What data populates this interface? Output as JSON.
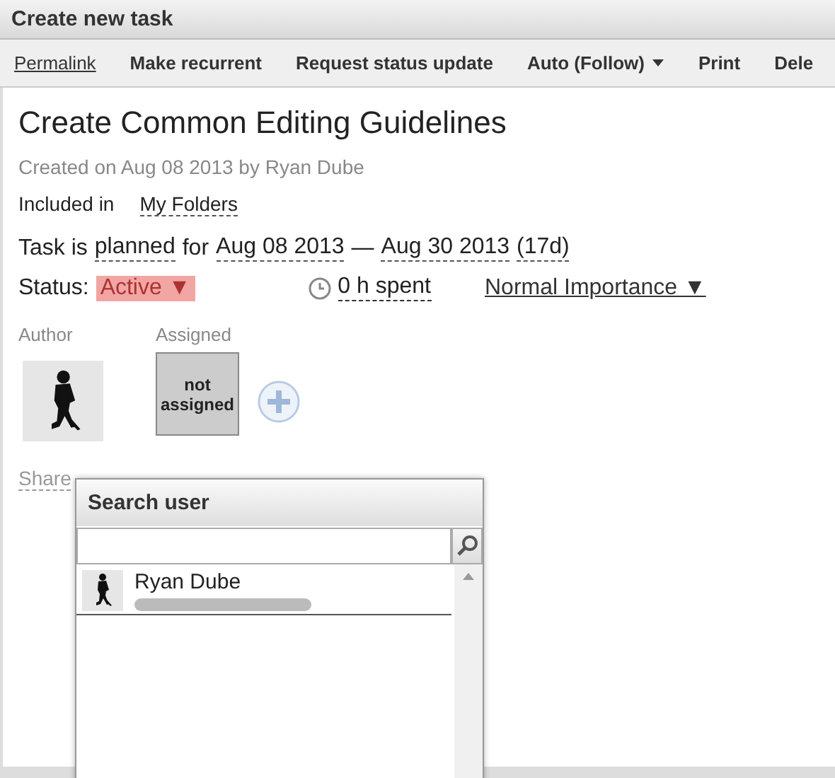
{
  "window": {
    "title": "Create new task"
  },
  "toolbar": [
    {
      "label": "Permalink",
      "kind": "link"
    },
    {
      "label": "Make recurrent",
      "kind": "action"
    },
    {
      "label": "Request status update",
      "kind": "action"
    },
    {
      "label": "Auto (Follow)",
      "kind": "dropdown"
    },
    {
      "label": "Print",
      "kind": "action"
    },
    {
      "label": "Dele",
      "kind": "action"
    }
  ],
  "task": {
    "title": "Create Common Editing Guidelines",
    "created": "Created on Aug 08 2013 by Ryan Dube",
    "included_label": "Included in",
    "folder": "My Folders",
    "plan": {
      "prefix": "Task is",
      "planned": "planned",
      "for": "for",
      "start": "Aug 08 2013",
      "dash": "—",
      "end": "Aug 30 2013",
      "duration": "(17d)"
    },
    "status_label": "Status:",
    "status": "Active ▼",
    "time_spent": "0 h spent",
    "importance": "Normal Importance ▼",
    "author_label": "Author",
    "assigned_label": "Assigned",
    "assignee": "not assigned",
    "share": "Share"
  },
  "popup": {
    "title": "Search user",
    "users": [
      {
        "name": "Ryan Dube",
        "selected": false
      }
    ]
  }
}
